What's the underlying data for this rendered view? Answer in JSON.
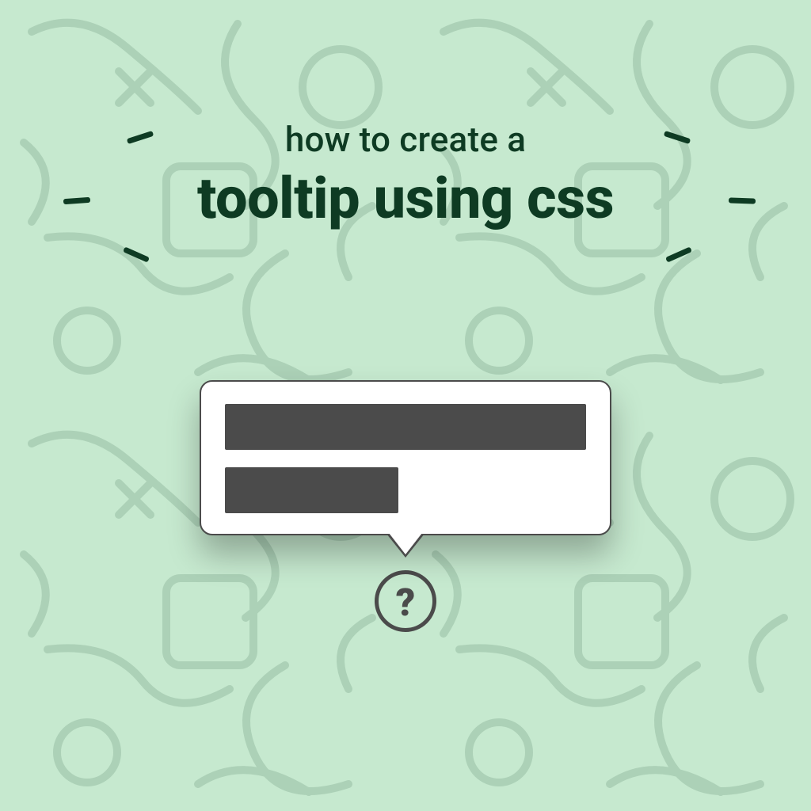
{
  "colors": {
    "bg": "#c6e9cf",
    "fg": "#0e3b23",
    "ui_dark": "#4b4b4b",
    "tooltip_bg": "#ffffff"
  },
  "heading": {
    "subtitle": "how to create a",
    "title": "tooltip using css"
  },
  "demo": {
    "help_glyph": "?",
    "placeholder_bar_count": 2
  }
}
